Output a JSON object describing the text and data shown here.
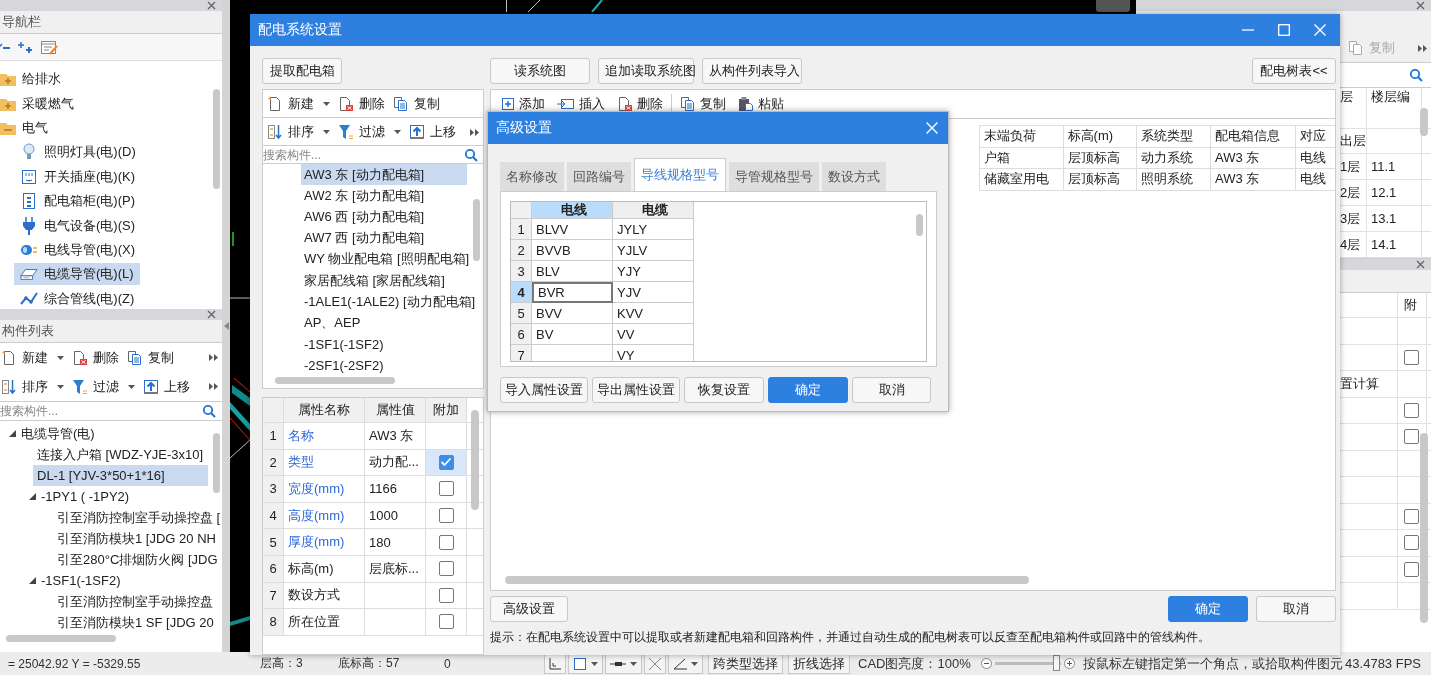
{
  "nav_panel": {
    "title": "导航栏",
    "tree": [
      {
        "label": "给排水",
        "expanded": false
      },
      {
        "label": "采暖燃气",
        "expanded": false
      },
      {
        "label": "电气",
        "expanded": true,
        "children": [
          {
            "label": "照明灯具(电)(D)",
            "selected": false
          },
          {
            "label": "开关插座(电)(K)",
            "selected": false
          },
          {
            "label": "配电箱柜(电)(P)",
            "selected": false
          },
          {
            "label": "电气设备(电)(S)",
            "selected": false
          },
          {
            "label": "电线导管(电)(X)",
            "selected": false
          },
          {
            "label": "电缆导管(电)(L)",
            "selected": true
          },
          {
            "label": "综合管线(电)(Z)",
            "selected": false
          }
        ]
      }
    ]
  },
  "component_panel": {
    "title": "构件列表",
    "toolbar_rows": [
      [
        {
          "label": "新建",
          "dropdown": true
        },
        {
          "label": "删除",
          "dropdown": false
        },
        {
          "label": "复制",
          "dropdown": false
        }
      ],
      [
        {
          "label": "排序",
          "dropdown": true
        },
        {
          "label": "过滤",
          "dropdown": true
        },
        {
          "label": "上移",
          "dropdown": false
        }
      ]
    ],
    "search": {
      "placeholder": "搜索构件..."
    },
    "tree": [
      {
        "label": "电缆导管(电)",
        "expanded": true,
        "selected": false,
        "children": [
          {
            "label": "连接入户箱 [WDZ-YJE-3x10]",
            "selected": false
          },
          {
            "label": "DL-1 [YJV-3*50+1*16]",
            "selected": true
          },
          {
            "label": "-1PY1 ( -1PY2)",
            "expanded": true,
            "selected": false,
            "children": [
              {
                "label": "引至消防控制室手动操控盘 [",
                "selected": false
              },
              {
                "label": "引至消防模块1 [JDG 20 NH",
                "selected": false
              },
              {
                "label": "引至280°C排烟防火阀 [JDG",
                "selected": false
              }
            ]
          },
          {
            "label": "-1SF1(-1SF2)",
            "expanded": true,
            "selected": false,
            "children": [
              {
                "label": "引至消防控制室手动操控盘",
                "selected": false
              },
              {
                "label": "引至消防模块1 SF [JDG 20",
                "selected": false
              }
            ]
          }
        ]
      }
    ]
  },
  "floor_panel": {
    "toolbar": [
      {
        "label": "复制",
        "disabled": true
      }
    ],
    "columns": [
      "层",
      "楼层编"
    ],
    "rows": [
      {
        "kind": "blank"
      },
      {
        "kind": "floor",
        "cells": [
          "出层"
        ]
      },
      {
        "kind": "floor",
        "cells": [
          "1层",
          "11.1"
        ]
      },
      {
        "kind": "floor",
        "cells": [
          "2层",
          "12.1"
        ]
      },
      {
        "kind": "floor",
        "cells": [
          "3层",
          "13.1"
        ]
      },
      {
        "kind": "floor",
        "cells": [
          "4层",
          "14.1"
        ]
      }
    ]
  },
  "attribute_panel": {
    "columns": [
      "附"
    ],
    "rows": [
      {
        "kind": "blank"
      },
      {
        "kind": "check",
        "checked": false
      },
      {
        "kind": "text",
        "text": "置计算"
      },
      {
        "kind": "check",
        "checked": false
      },
      {
        "kind": "check",
        "checked": false
      },
      {
        "kind": "blank"
      },
      {
        "kind": "blank"
      },
      {
        "kind": "check",
        "checked": false
      },
      {
        "kind": "check",
        "checked": false
      },
      {
        "kind": "check",
        "checked": false
      },
      {
        "kind": "blank"
      }
    ]
  },
  "status_bar": {
    "coordinates": "= 25042.92 Y = -5329.55",
    "floor_height": "层高：3",
    "bottom_elevation": "底标高：57",
    "value": "0",
    "buttons": [
      "跨类型选择",
      "折线选择"
    ],
    "brightness": {
      "label": "CAD图亮度：100%",
      "level": 1.0
    },
    "hint": "按鼠标左键指定第一个角点，或拾取构件图元",
    "fps": "43.4783 FPS"
  },
  "main_dialog": {
    "title": "配电系统设置",
    "extract_button": "提取配电箱",
    "toolbar_rows": [
      [
        {
          "label": "新建",
          "dropdown": true
        },
        {
          "label": "删除",
          "dropdown": false
        },
        {
          "label": "复制",
          "dropdown": false
        }
      ],
      [
        {
          "label": "排序",
          "dropdown": true
        },
        {
          "label": "过滤",
          "dropdown": true
        },
        {
          "label": "上移",
          "dropdown": false
        }
      ]
    ],
    "search": {
      "placeholder": "搜索构件..."
    },
    "boxes": [
      {
        "label": "AW3 东 [动力配电箱]",
        "selected": true
      },
      {
        "label": "AW2 东 [动力配电箱]",
        "selected": false
      },
      {
        "label": "AW6 西 [动力配电箱]",
        "selected": false
      },
      {
        "label": "AW7 西 [动力配电箱]",
        "selected": false
      },
      {
        "label": "WY 物业配电箱 [照明配电箱]",
        "selected": false
      },
      {
        "label": "家居配线箱 [家居配线箱]",
        "selected": false
      },
      {
        "label": "-1ALE1(-1ALE2) [动力配电箱]",
        "selected": false
      },
      {
        "label": "AP、AEP",
        "selected": false
      },
      {
        "label": "-1SF1(-1SF2)",
        "selected": false
      },
      {
        "label": "-2SF1(-2SF2)",
        "selected": false
      }
    ],
    "properties": {
      "columns": [
        "属性名称",
        "属性值",
        "附加"
      ],
      "rows": [
        {
          "num": "1",
          "name": "名称",
          "value": "AW3 东",
          "public": true,
          "selected": false
        },
        {
          "num": "2",
          "name": "类型",
          "value": "动力配...",
          "public": true,
          "checked": true,
          "selected": true
        },
        {
          "num": "3",
          "name": "宽度(mm)",
          "value": "1166",
          "public": true,
          "checked": false,
          "selected": false
        },
        {
          "num": "4",
          "name": "高度(mm)",
          "value": "1000",
          "public": true,
          "checked": false,
          "selected": false
        },
        {
          "num": "5",
          "name": "厚度(mm)",
          "value": "180",
          "public": true,
          "checked": false,
          "selected": false
        },
        {
          "num": "6",
          "name": "标高(m)",
          "value": "层底标...",
          "public": false,
          "checked": false,
          "selected": false
        },
        {
          "num": "7",
          "name": "数设方式",
          "public": false,
          "checked": false,
          "selected": false
        },
        {
          "num": "8",
          "name": "所在位置",
          "public": false,
          "checked": false,
          "selected": false
        }
      ]
    },
    "read_buttons": [
      "读系统图",
      "追加读取系统图",
      "从构件列表导入"
    ],
    "tree_button": "配电树表<<",
    "table_toolbar": [
      {
        "label": "添加",
        "separator_before": false
      },
      {
        "label": "插入",
        "separator_before": false
      },
      {
        "label": "删除",
        "separator_before": false
      },
      {
        "label": "复制",
        "separator_before": true
      },
      {
        "label": "粘贴",
        "separator_before": false
      }
    ],
    "table": {
      "columns": [
        "末端负荷",
        "标高(m)",
        "系统类型",
        "配电箱信息",
        "对应"
      ],
      "rows": [
        {
          "cells": [
            "户箱",
            "层顶标高",
            "动力系统",
            "AW3 东",
            "电线"
          ]
        },
        {
          "cells": [
            "储藏室用电",
            "层顶标高",
            "照明系统",
            "AW3 东",
            "电线"
          ]
        }
      ]
    },
    "advanced_button": "高级设置",
    "buttons": [
      {
        "label": "确定",
        "primary": true
      },
      {
        "label": "取消",
        "primary": false
      }
    ],
    "hint": "提示：在配电系统设置中可以提取或者新建配电箱和回路构件，并通过自动生成的配电树表可以反查至配电箱构件或回路中的管线构件。"
  },
  "advanced_dialog": {
    "title": "高级设置",
    "tabs": [
      {
        "label": "名称修改",
        "selected": false
      },
      {
        "label": "回路编号",
        "selected": false
      },
      {
        "label": "导线规格型号",
        "selected": true
      },
      {
        "label": "导管规格型号",
        "selected": false
      },
      {
        "label": "数设方式",
        "selected": false
      }
    ],
    "grid": {
      "columns": [
        {
          "label": "电线",
          "selected": true
        },
        {
          "label": "电缆",
          "selected": false
        }
      ],
      "rows": [
        {
          "num": "1",
          "wire": "BLVV",
          "cable": "JYLY",
          "selected": false
        },
        {
          "num": "2",
          "wire": "BVVB",
          "cable": "YJLV",
          "selected": false
        },
        {
          "num": "3",
          "wire": "BLV",
          "cable": "YJY",
          "selected": false
        },
        {
          "num": "4",
          "wire": "BVR",
          "cable": "YJV",
          "selected": true
        },
        {
          "num": "5",
          "wire": "BVV",
          "cable": "KVV",
          "selected": false
        },
        {
          "num": "6",
          "wire": "BV",
          "cable": "VV",
          "selected": false
        },
        {
          "num": "7",
          "cable": "VY",
          "selected": false
        }
      ]
    },
    "buttons": [
      {
        "label": "导入属性设置",
        "primary": false
      },
      {
        "label": "导出属性设置",
        "primary": false
      },
      {
        "label": "恢复设置",
        "primary": false
      },
      {
        "label": "确定",
        "primary": true
      },
      {
        "label": "取消",
        "primary": false
      }
    ]
  }
}
